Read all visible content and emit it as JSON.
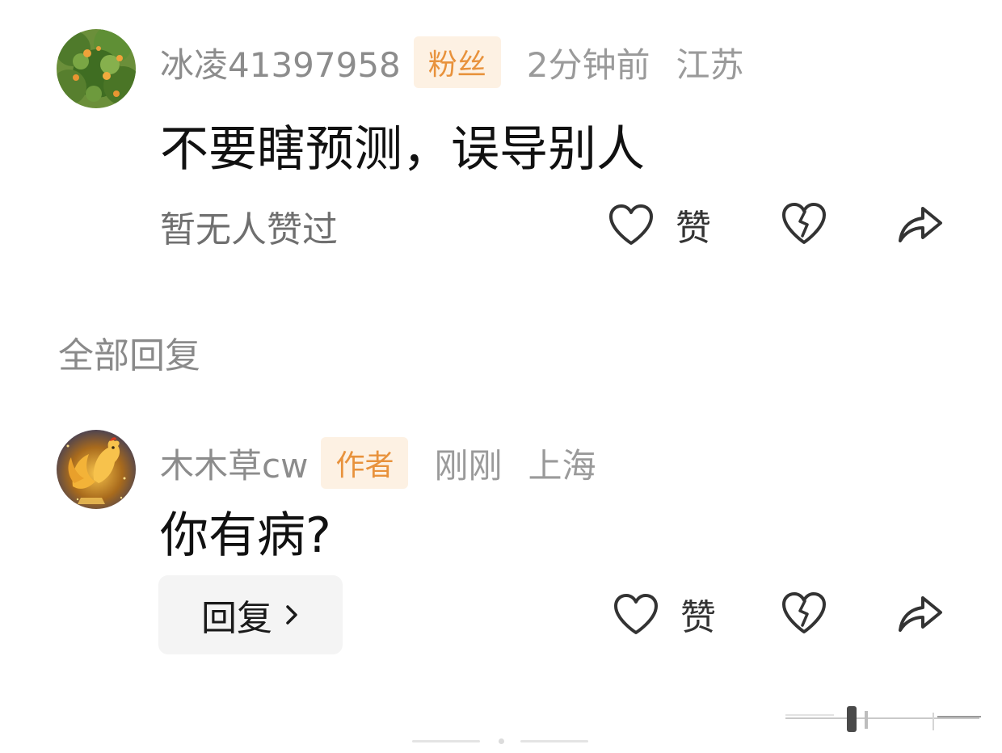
{
  "comments": [
    {
      "username": "冰凌41397958",
      "badge": "粉丝",
      "time": "2分钟前",
      "location": "江苏",
      "text": "不要瞎预测，误导别人",
      "likers_text": "暂无人赞过",
      "like_label": "赞",
      "avatar_icon": "orange-tree-avatar"
    },
    {
      "username": "木木草cw",
      "badge": "作者",
      "time": "刚刚",
      "location": "上海",
      "text": "你有病?",
      "reply_label": "回复",
      "like_label": "赞",
      "avatar_icon": "golden-rooster-avatar"
    }
  ],
  "section": {
    "all_replies_label": "全部回复"
  },
  "colors": {
    "badge_bg": "#fdf1e3",
    "badge_text": "#e8923c",
    "meta_text": "#8c8c8c",
    "reply_button_bg": "#f4f4f4"
  },
  "icons": {
    "like": "heart-outline-icon",
    "dislike": "broken-heart-icon",
    "share": "share-arrow-icon",
    "reply_chevron": "chevron-right-icon"
  }
}
